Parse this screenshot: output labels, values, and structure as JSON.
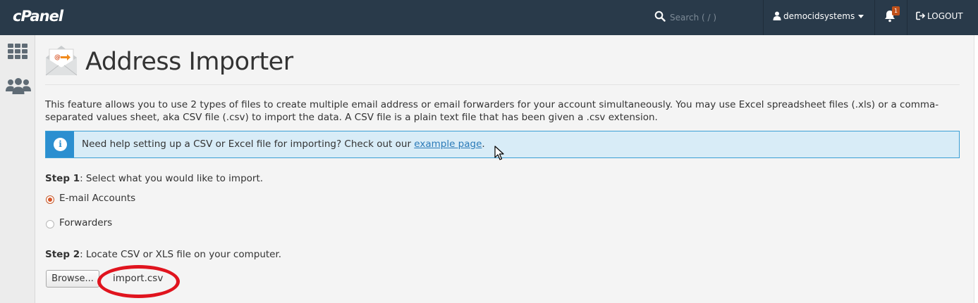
{
  "topbar": {
    "logo_text": "cPanel",
    "search_placeholder": "Search ( / )",
    "username": "democidsystems",
    "notification_count": "1",
    "logout_label": "LOGOUT"
  },
  "sidebar": {
    "items": [
      {
        "icon": "grid-icon"
      },
      {
        "icon": "users-icon"
      }
    ]
  },
  "page": {
    "title": "Address Importer",
    "description": "This feature allows you to use 2 types of files to create multiple email address or email forwarders for your account simultaneously. You may use Excel spreadsheet files (.xls) or a comma-separated values sheet, aka CSV file (.csv) to import the data. A CSV file is a plain text file that has been given a .csv extension.",
    "alert": {
      "text_before": "Need help setting up a CSV or Excel file for importing? Check out our ",
      "link_text": "example page",
      "text_after": "."
    },
    "step1": {
      "label": "Step 1",
      "text": ": Select what you would like to import.",
      "options": [
        {
          "label": "E-mail Accounts",
          "checked": true
        },
        {
          "label": "Forwarders",
          "checked": false
        }
      ]
    },
    "step2": {
      "label": "Step 2",
      "text": ": Locate CSV or XLS file on your computer.",
      "browse_label": "Browse...",
      "file_name": "import.csv"
    }
  },
  "colors": {
    "topbar_bg": "#293a4a",
    "accent_orange": "#d8572a",
    "alert_bg": "#d8ecf7",
    "alert_icon_bg": "#2c8fd0",
    "annotation_red": "#e0141e"
  }
}
